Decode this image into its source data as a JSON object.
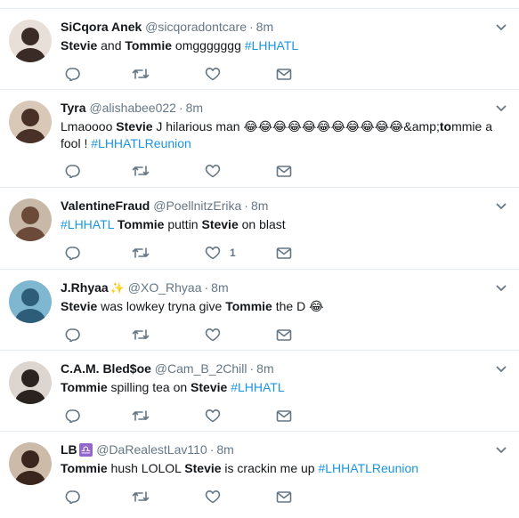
{
  "tweets": [
    {
      "name": "SiCqora Anek",
      "badge": "",
      "handle": "@sicqoradontcare",
      "time": "8m",
      "segments": [
        {
          "t": "Stevie",
          "s": "b"
        },
        {
          "t": " and ",
          "s": "n"
        },
        {
          "t": "Tommie",
          "s": "b"
        },
        {
          "t": " omggggggg ",
          "s": "n"
        },
        {
          "t": "#LHHATL",
          "s": "h"
        }
      ],
      "like_count": ""
    },
    {
      "name": "Tyra",
      "badge": "",
      "handle": "@alishabee022",
      "time": "8m",
      "segments": [
        {
          "t": "Lmaoooo ",
          "s": "n"
        },
        {
          "t": "Stevie",
          "s": "b"
        },
        {
          "t": " J hilarious man ",
          "s": "n"
        },
        {
          "t": "😂😂😂😂😂😂😂😂😂😂😂",
          "s": "e"
        },
        {
          "t": "&amp;",
          "s": "n"
        },
        {
          "t": "to",
          "s": "b"
        },
        {
          "t": "mmie a fool !  ",
          "s": "n"
        },
        {
          "t": "#LHHATLReunion",
          "s": "h"
        }
      ],
      "like_count": ""
    },
    {
      "name": "ValentineFraud",
      "badge": "",
      "handle": "@PoellnitzErika",
      "time": "8m",
      "segments": [
        {
          "t": "#LHHATL",
          "s": "h"
        },
        {
          "t": " ",
          "s": "n"
        },
        {
          "t": "Tommie",
          "s": "b"
        },
        {
          "t": " puttin ",
          "s": "n"
        },
        {
          "t": "Stevie",
          "s": "b"
        },
        {
          "t": " on blast",
          "s": "n"
        }
      ],
      "like_count": "1"
    },
    {
      "name": "J.Rhyaa",
      "badge": "✨",
      "handle": "@XO_Rhyaa",
      "time": "8m",
      "segments": [
        {
          "t": "Stevie",
          "s": "b"
        },
        {
          "t": " was lowkey tryna give ",
          "s": "n"
        },
        {
          "t": "Tommie",
          "s": "b"
        },
        {
          "t": " the D ",
          "s": "n"
        },
        {
          "t": "😂",
          "s": "e"
        }
      ],
      "like_count": ""
    },
    {
      "name": "C.A.M. Bled$oe",
      "badge": "",
      "handle": "@Cam_B_2Chill",
      "time": "8m",
      "segments": [
        {
          "t": "Tommie",
          "s": "b"
        },
        {
          "t": " spilling tea on ",
          "s": "n"
        },
        {
          "t": "Stevie",
          "s": "b"
        },
        {
          "t": " ",
          "s": "n"
        },
        {
          "t": "#LHHATL",
          "s": "h"
        }
      ],
      "like_count": ""
    },
    {
      "name": "LB",
      "badge": "♎",
      "handle": "@DaRealestLav110",
      "time": "8m",
      "segments": [
        {
          "t": "Tommie",
          "s": "b"
        },
        {
          "t": " hush LOLOL ",
          "s": "n"
        },
        {
          "t": "Stevie",
          "s": "b"
        },
        {
          "t": " is crackin me up ",
          "s": "n"
        },
        {
          "t": "#LHHATLReunion",
          "s": "h"
        }
      ],
      "like_count": ""
    }
  ],
  "icons": {
    "reply": "reply-icon",
    "retweet": "retweet-icon",
    "like": "heart-icon",
    "dm": "envelope-icon",
    "caret": "chevron-down-icon"
  },
  "colors": {
    "hashtag": "#1b95e0",
    "meta": "#657786",
    "divider": "#e6ecf0",
    "badge_bg": "#9266cc"
  }
}
